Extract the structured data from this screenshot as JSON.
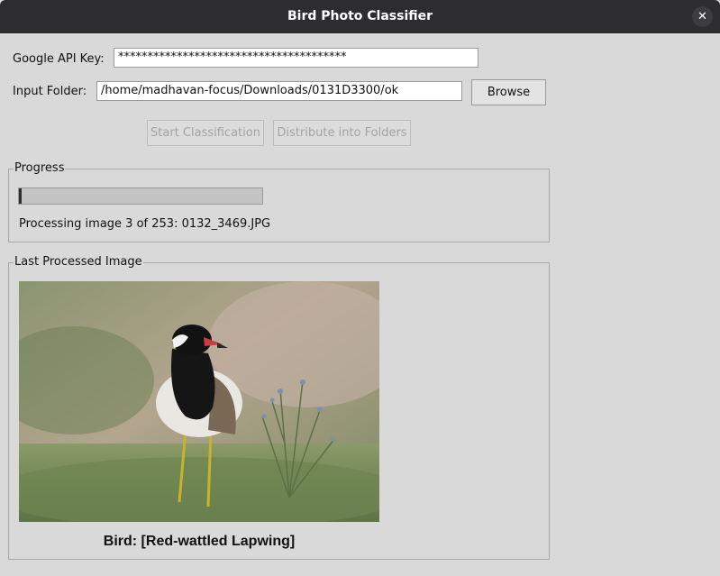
{
  "window": {
    "title": "Bird Photo Classifier",
    "close_glyph": "✕"
  },
  "form": {
    "api_key_label": "Google API Key:",
    "api_key_value": "***************************************",
    "folder_label": "Input Folder:",
    "folder_value": "/home/madhavan-focus/Downloads/0131D3300/ok",
    "browse_label": "Browse"
  },
  "actions": {
    "start_label": "Start Classification",
    "distribute_label": "Distribute into Folders"
  },
  "progress": {
    "group_label": "Progress",
    "fraction": 0.012,
    "status_text": "Processing image 3 of 253: 0132_3469.JPG"
  },
  "last_image": {
    "group_label": "Last Processed Image",
    "caption": "Bird: [Red-wattled Lapwing]"
  },
  "icons": {
    "close": "close-icon"
  }
}
